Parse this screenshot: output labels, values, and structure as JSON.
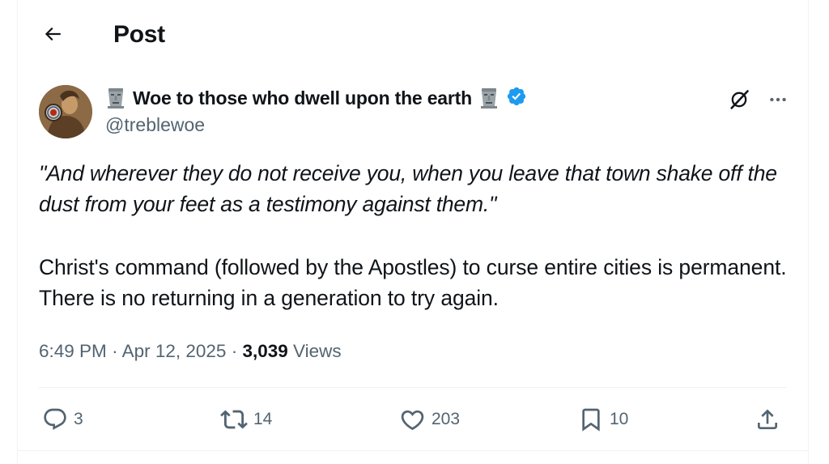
{
  "header": {
    "title": "Post",
    "back_icon": "arrow-left-icon"
  },
  "author": {
    "name": "Woe to those who dwell upon the earth",
    "handle": "@treblewoe",
    "verified": true,
    "verified_color": "#1d9bf0",
    "name_emoji": "moai-icon"
  },
  "tweet": {
    "quote": "\"And wherever they do not receive you, when you leave that town shake off the dust from your feet as a testimony against them.\"",
    "body": "Christ's command (followed by the Apostles) to curse entire cities is permanent. There is no returning in a generation to try again."
  },
  "meta": {
    "time": "6:49 PM",
    "date": "Apr 12, 2025",
    "views_count": "3,039",
    "views_label": "Views"
  },
  "actions": {
    "replies": "3",
    "reposts": "14",
    "likes": "203",
    "bookmarks": "10"
  },
  "colors": {
    "text_primary": "#0f1419",
    "text_secondary": "#536471",
    "border": "#eff3f4"
  }
}
